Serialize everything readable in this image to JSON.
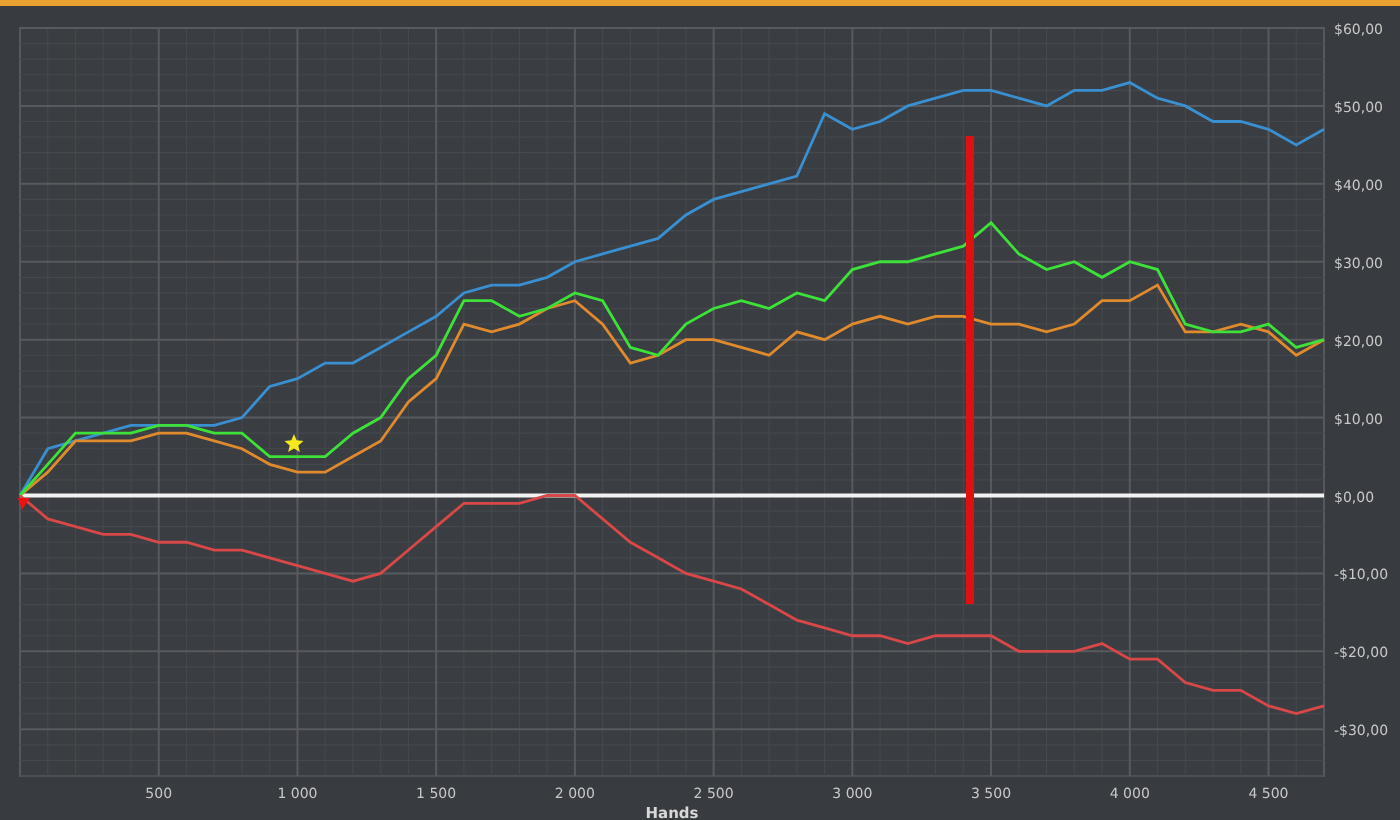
{
  "chart_data": {
    "type": "line",
    "xlabel": "Hands",
    "xlim": [
      0,
      4700
    ],
    "ylim": [
      -36,
      60
    ],
    "x": [
      0,
      100,
      200,
      300,
      400,
      500,
      600,
      700,
      800,
      900,
      1000,
      1100,
      1200,
      1300,
      1400,
      1500,
      1600,
      1700,
      1800,
      1900,
      2000,
      2100,
      2200,
      2300,
      2400,
      2500,
      2600,
      2700,
      2800,
      2900,
      3000,
      3100,
      3200,
      3300,
      3400,
      3500,
      3600,
      3700,
      3800,
      3900,
      4000,
      4100,
      4200,
      4300,
      4400,
      4500,
      4600,
      4700
    ],
    "series": [
      {
        "color": "#3a8fd0",
        "values": [
          0,
          6,
          7,
          8,
          9,
          9,
          9,
          9,
          10,
          14,
          15,
          17,
          17,
          19,
          21,
          23,
          26,
          27,
          27,
          28,
          30,
          31,
          32,
          33,
          36,
          38,
          39,
          40,
          41,
          49,
          47,
          48,
          50,
          51,
          52,
          52,
          51,
          50,
          52,
          52,
          53,
          51,
          50,
          48,
          48,
          47,
          45,
          47
        ]
      },
      {
        "color": "#e08a2e",
        "values": [
          0,
          3,
          7,
          7,
          7,
          8,
          8,
          7,
          6,
          4,
          3,
          3,
          5,
          7,
          12,
          15,
          22,
          21,
          22,
          24,
          25,
          22,
          17,
          18,
          20,
          20,
          19,
          18,
          21,
          20,
          22,
          23,
          22,
          23,
          23,
          22,
          22,
          21,
          22,
          25,
          25,
          27,
          21,
          21,
          22,
          21,
          18,
          20
        ]
      },
      {
        "color": "#3ee03a",
        "values": [
          0,
          4,
          8,
          8,
          8,
          9,
          9,
          8,
          8,
          5,
          5,
          5,
          8,
          10,
          15,
          18,
          25,
          25,
          23,
          24,
          26,
          25,
          19,
          18,
          22,
          24,
          25,
          24,
          26,
          25,
          29,
          30,
          30,
          31,
          32,
          35,
          31,
          29,
          30,
          28,
          30,
          29,
          22,
          21,
          21,
          22,
          19,
          20
        ]
      },
      {
        "color": "#d84848",
        "values": [
          0,
          -3,
          -4,
          -5,
          -5,
          -6,
          -6,
          -7,
          -7,
          -8,
          -9,
          -10,
          -11,
          -10,
          -7,
          -4,
          -1,
          -1,
          -1,
          0,
          0,
          -3,
          -6,
          -8,
          -10,
          -11,
          -12,
          -14,
          -16,
          -17,
          -18,
          -18,
          -19,
          -18,
          -18,
          -18,
          -20,
          -20,
          -20,
          -19,
          -21,
          -21,
          -24,
          -25,
          -25,
          -27,
          -28,
          -27
        ]
      }
    ],
    "xticks": [
      {
        "value": 500,
        "label": "500"
      },
      {
        "value": 1000,
        "label": "1 000"
      },
      {
        "value": 1500,
        "label": "1 500"
      },
      {
        "value": 2000,
        "label": "2 000"
      },
      {
        "value": 2500,
        "label": "2 500"
      },
      {
        "value": 3000,
        "label": "3 000"
      },
      {
        "value": 3500,
        "label": "3 500"
      },
      {
        "value": 4000,
        "label": "4 000"
      },
      {
        "value": 4500,
        "label": "4 500"
      }
    ],
    "yticks": [
      {
        "value": 60,
        "label": "$60,00"
      },
      {
        "value": 50,
        "label": "$50,00"
      },
      {
        "value": 40,
        "label": "$40,00"
      },
      {
        "value": 30,
        "label": "$30,00"
      },
      {
        "value": 20,
        "label": "$20,00"
      },
      {
        "value": 10,
        "label": "$10,00"
      },
      {
        "value": 0,
        "label": "$0,00"
      },
      {
        "value": -10,
        "label": "-$10,00"
      },
      {
        "value": -20,
        "label": "-$20,00"
      },
      {
        "value": -30,
        "label": "-$30,00"
      }
    ],
    "grid": true
  }
}
